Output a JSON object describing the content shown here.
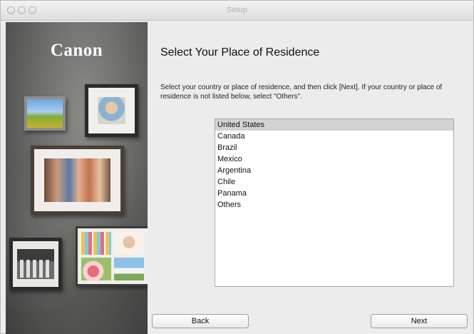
{
  "window": {
    "title": "Setup"
  },
  "brand": {
    "logo": "Canon"
  },
  "page": {
    "heading": "Select Your Place of Residence",
    "instruction": "Select your country or place of residence, and then click [Next]. If your country or place of residence is not listed below, select \"Others\"."
  },
  "countries": {
    "selected_index": 0,
    "items": [
      "United States",
      "Canada",
      "Brazil",
      "Mexico",
      "Argentina",
      "Chile",
      "Panama",
      "Others"
    ]
  },
  "buttons": {
    "back": "Back",
    "next": "Next"
  },
  "colors": {
    "selection": "#d3d3d3",
    "panel_background": "#ececec"
  }
}
